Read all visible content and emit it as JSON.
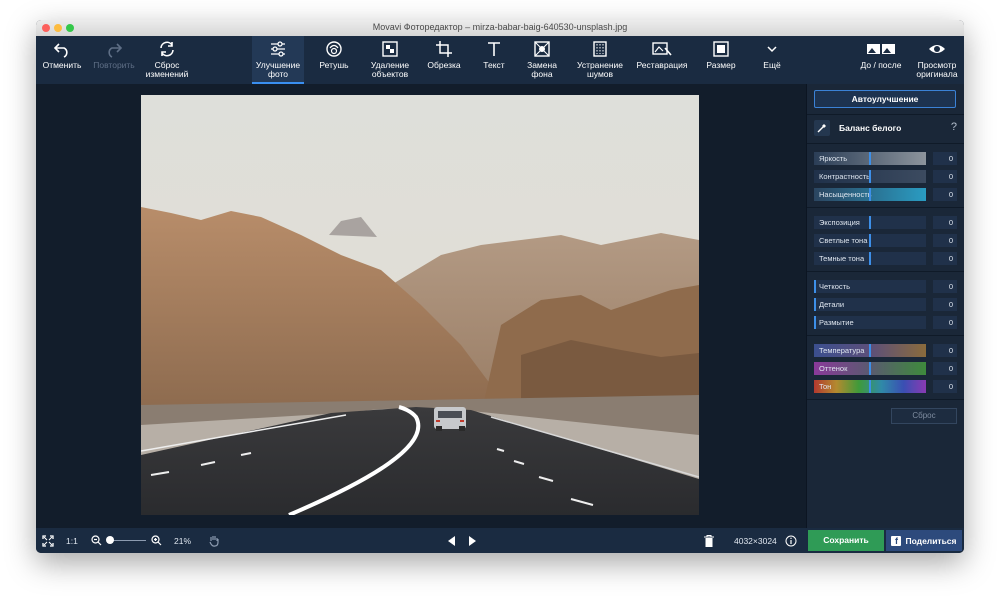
{
  "window": {
    "title": "Movavi Фоторедактор – mirza-babar-baig-640530-unsplash.jpg"
  },
  "toolbar": {
    "undo": "Отменить",
    "redo": "Повторить",
    "reset": "Сброс\nизменений",
    "enhance": "Улучшение\nфото",
    "retouch": "Ретушь",
    "remove_objects": "Удаление\nобъектов",
    "crop": "Обрезка",
    "text": "Текст",
    "replace_bg": "Замена\nфона",
    "denoise": "Устранение\nшумов",
    "restore": "Реставрация",
    "resize": "Размер",
    "more": "Ещё",
    "before_after": "До / после",
    "preview_original": "Просмотр\nоригинала"
  },
  "panel": {
    "auto_enhance": "Автоулучшение",
    "white_balance": "Баланс белого",
    "help": "?",
    "groups": [
      [
        {
          "label": "Яркость",
          "value": "0"
        },
        {
          "label": "Контрастность",
          "value": "0"
        },
        {
          "label": "Насыщенность",
          "value": "0"
        }
      ],
      [
        {
          "label": "Экспозиция",
          "value": "0"
        },
        {
          "label": "Светлые тона",
          "value": "0"
        },
        {
          "label": "Темные тона",
          "value": "0"
        }
      ],
      [
        {
          "label": "Четкость",
          "value": "0"
        },
        {
          "label": "Детали",
          "value": "0"
        },
        {
          "label": "Размытие",
          "value": "0"
        }
      ],
      [
        {
          "label": "Температура",
          "value": "0"
        },
        {
          "label": "Оттенок",
          "value": "0"
        },
        {
          "label": "Тон",
          "value": "0"
        }
      ]
    ],
    "reset": "Сброс"
  },
  "status": {
    "one_to_one": "1:1",
    "zoom": "21%",
    "dimensions": "4032×3024",
    "save": "Сохранить",
    "share": "Поделиться"
  },
  "colors": {
    "accent": "#3a8ff0",
    "save_green": "#2f9b56",
    "share_blue": "#2d4a7c"
  }
}
